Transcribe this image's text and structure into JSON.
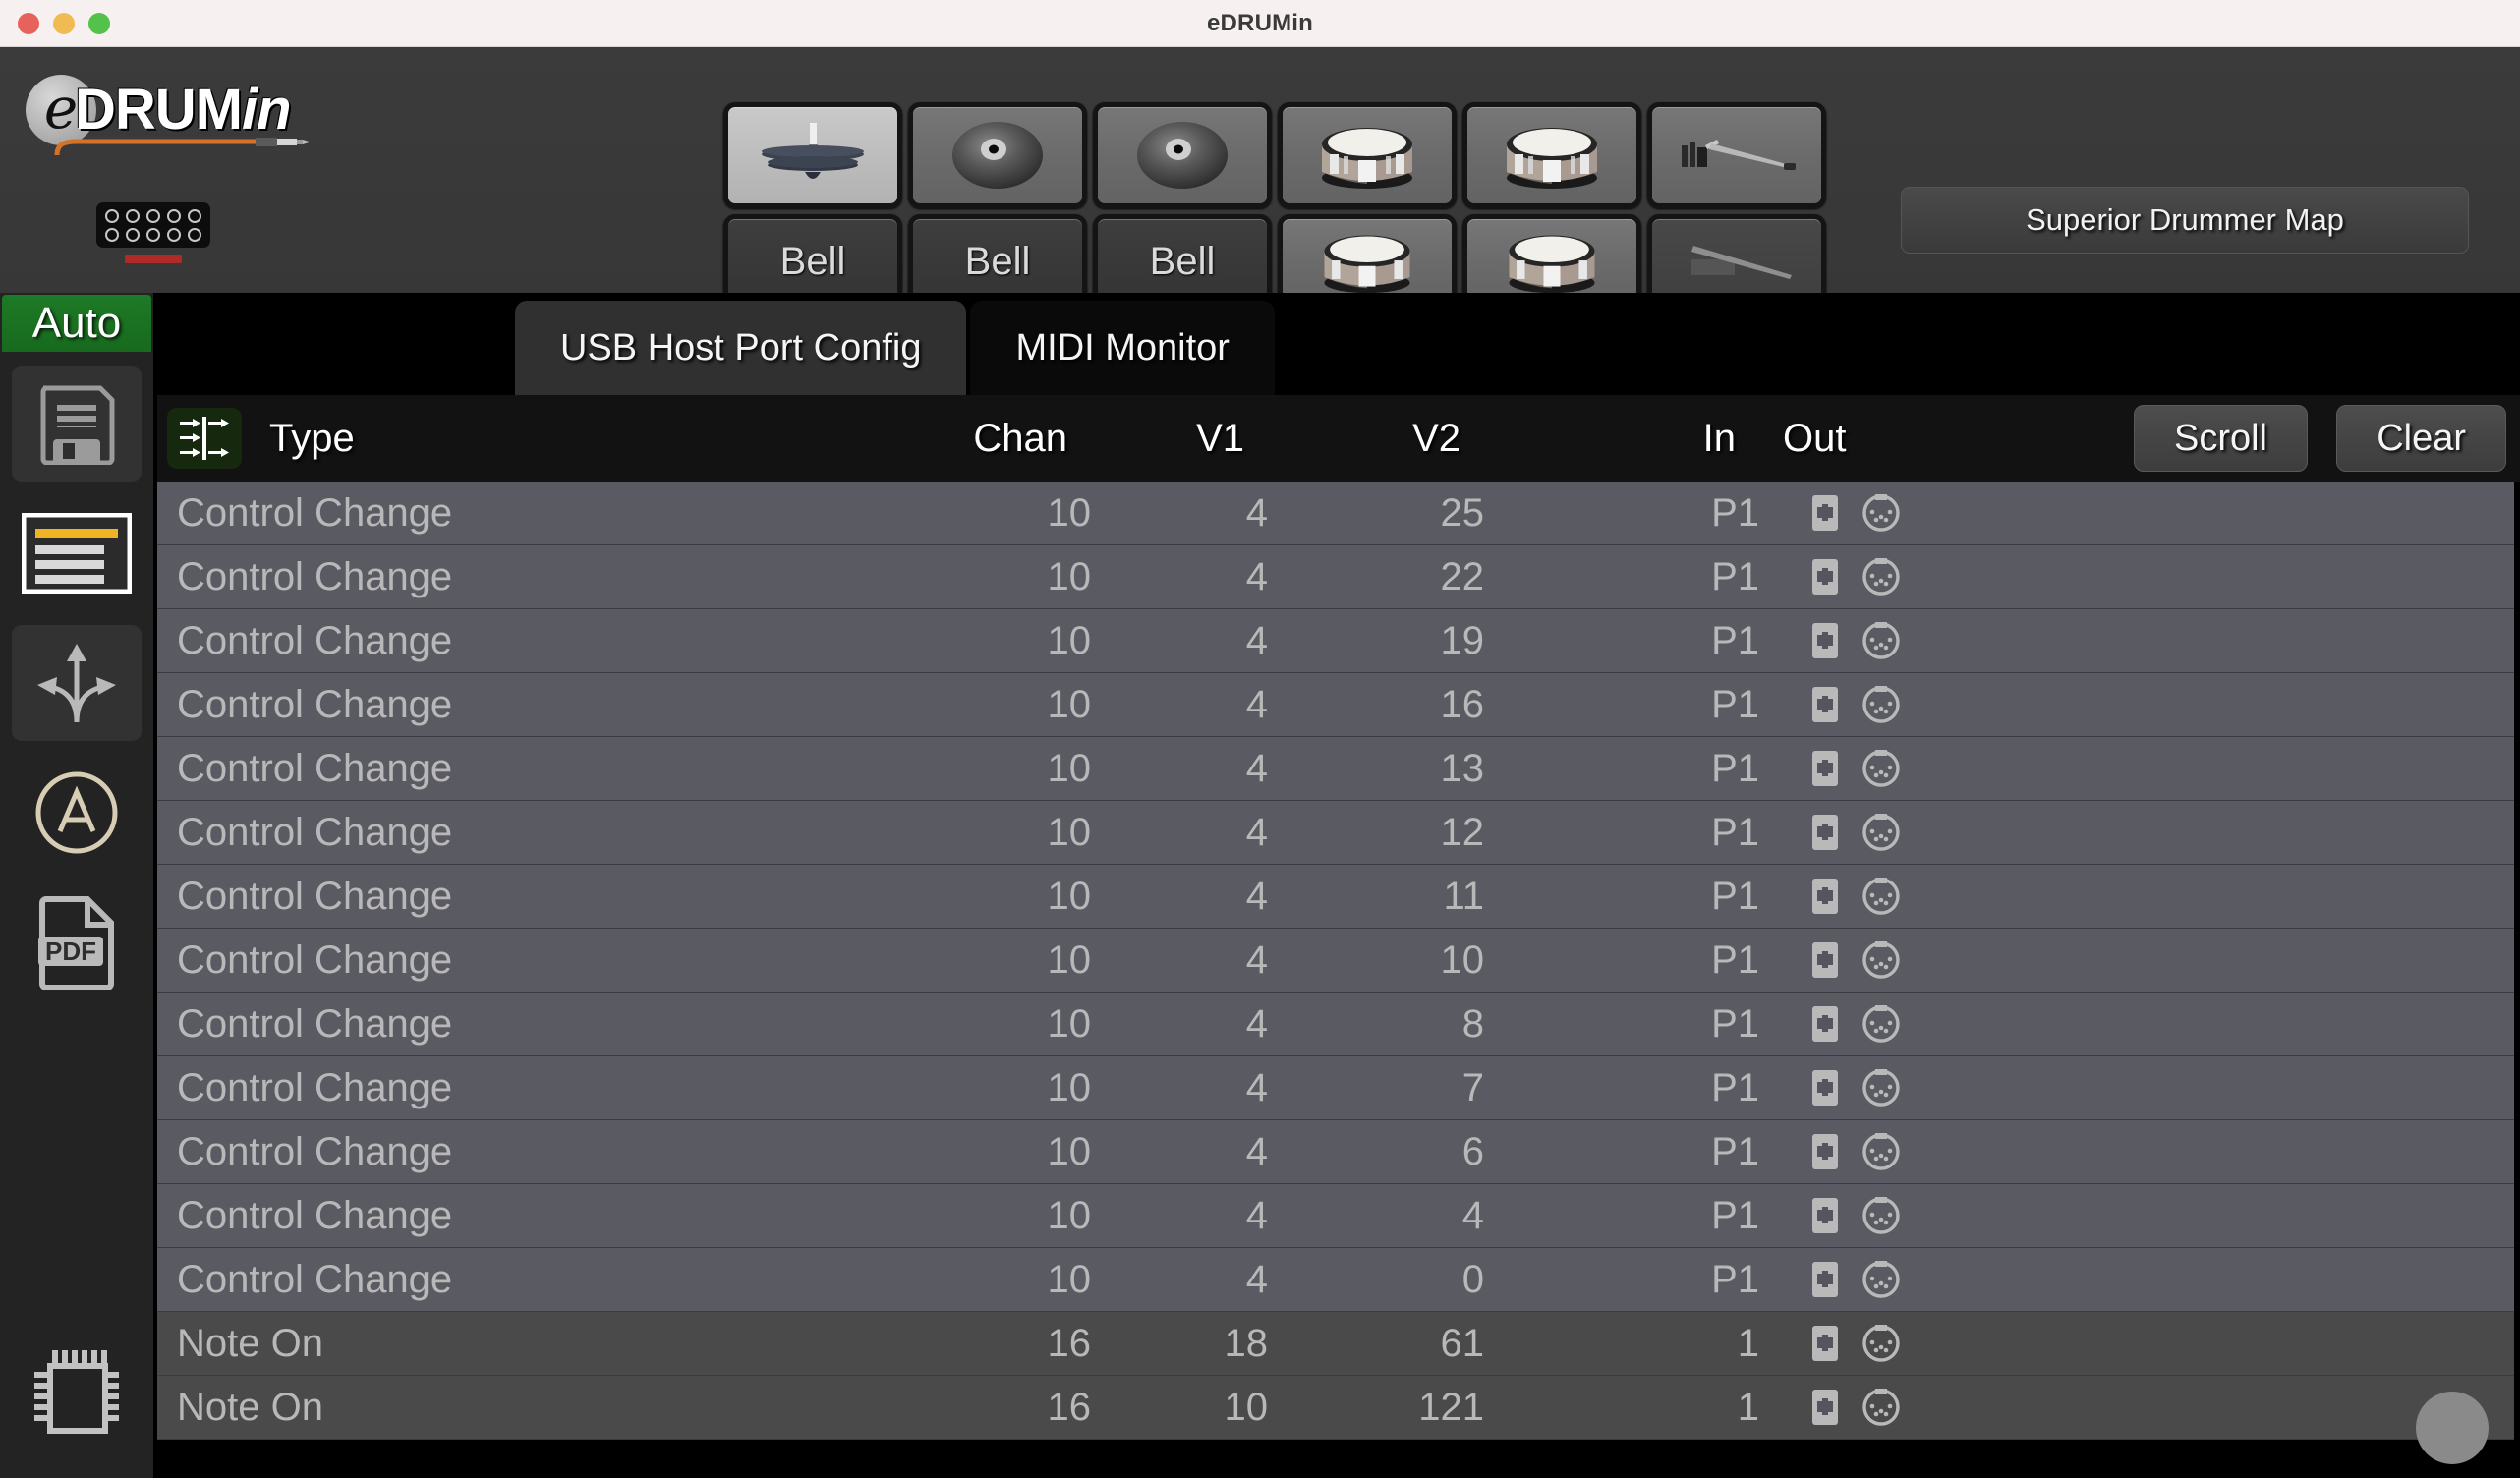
{
  "window": {
    "title": "eDRUMin"
  },
  "titlebar": {
    "close": "close-button",
    "minimize": "minimize-button",
    "maximize": "maximize-button"
  },
  "branding": {
    "logo_e": "e",
    "logo_text_main": "DRUM",
    "logo_text_italic": "in"
  },
  "device": {
    "holes": 10,
    "led_color": "#b02a28"
  },
  "pads": {
    "top_row": [
      {
        "icon": "hihat-icon",
        "selected": true
      },
      {
        "icon": "cymbal-icon",
        "selected": false
      },
      {
        "icon": "cymbal-icon",
        "selected": false
      },
      {
        "icon": "drum-icon",
        "selected": false
      },
      {
        "icon": "drum-icon",
        "selected": false
      },
      {
        "icon": "hihat-pedal-icon",
        "selected": false
      }
    ],
    "bottom_row": [
      {
        "label": "Bell",
        "icon": null
      },
      {
        "label": "Bell",
        "icon": null
      },
      {
        "label": "Bell",
        "icon": null
      },
      {
        "label": "",
        "icon": "drum-icon"
      },
      {
        "label": "",
        "icon": "drum-icon"
      },
      {
        "label": "",
        "icon": "hihat-pedal-faded-icon"
      }
    ]
  },
  "header": {
    "superior_drummer_map": "Superior Drummer Map"
  },
  "sidebar": {
    "auto_label": "Auto",
    "items": [
      {
        "name": "save-icon",
        "label": "save"
      },
      {
        "name": "list-icon",
        "label": "list"
      },
      {
        "name": "routing-arrows-icon",
        "label": "routing"
      },
      {
        "name": "circle-a-icon",
        "label": "circle-a"
      },
      {
        "name": "pdf-icon",
        "label": "pdf"
      },
      {
        "name": "chip-icon",
        "label": "chip"
      }
    ]
  },
  "tabs": [
    {
      "label": "USB Host Port Config",
      "active": true
    },
    {
      "label": "MIDI Monitor",
      "active": false
    }
  ],
  "monitor": {
    "filter_icon": "filter-routing-icon",
    "columns": [
      "Type",
      "Chan",
      "V1",
      "V2",
      "In",
      "Out"
    ],
    "scroll_label": "Scroll",
    "clear_label": "Clear",
    "out_icons": [
      "usb-port-icon",
      "midi-din-icon"
    ],
    "rows": [
      {
        "type": "Control Change",
        "chan": "10",
        "v1": "4",
        "v2": "25",
        "in": "P1",
        "kind": "cc"
      },
      {
        "type": "Control Change",
        "chan": "10",
        "v1": "4",
        "v2": "22",
        "in": "P1",
        "kind": "cc"
      },
      {
        "type": "Control Change",
        "chan": "10",
        "v1": "4",
        "v2": "19",
        "in": "P1",
        "kind": "cc"
      },
      {
        "type": "Control Change",
        "chan": "10",
        "v1": "4",
        "v2": "16",
        "in": "P1",
        "kind": "cc"
      },
      {
        "type": "Control Change",
        "chan": "10",
        "v1": "4",
        "v2": "13",
        "in": "P1",
        "kind": "cc"
      },
      {
        "type": "Control Change",
        "chan": "10",
        "v1": "4",
        "v2": "12",
        "in": "P1",
        "kind": "cc"
      },
      {
        "type": "Control Change",
        "chan": "10",
        "v1": "4",
        "v2": "11",
        "in": "P1",
        "kind": "cc"
      },
      {
        "type": "Control Change",
        "chan": "10",
        "v1": "4",
        "v2": "10",
        "in": "P1",
        "kind": "cc"
      },
      {
        "type": "Control Change",
        "chan": "10",
        "v1": "4",
        "v2": "8",
        "in": "P1",
        "kind": "cc"
      },
      {
        "type": "Control Change",
        "chan": "10",
        "v1": "4",
        "v2": "7",
        "in": "P1",
        "kind": "cc"
      },
      {
        "type": "Control Change",
        "chan": "10",
        "v1": "4",
        "v2": "6",
        "in": "P1",
        "kind": "cc"
      },
      {
        "type": "Control Change",
        "chan": "10",
        "v1": "4",
        "v2": "4",
        "in": "P1",
        "kind": "cc"
      },
      {
        "type": "Control Change",
        "chan": "10",
        "v1": "4",
        "v2": "0",
        "in": "P1",
        "kind": "cc"
      },
      {
        "type": "Note On",
        "chan": "16",
        "v1": "18",
        "v2": "61",
        "in": "1",
        "kind": "note"
      },
      {
        "type": "Note On",
        "chan": "16",
        "v1": "10",
        "v2": "121",
        "in": "1",
        "kind": "note"
      }
    ]
  },
  "colors": {
    "accent_green": "#1e7a26",
    "panel": "#3b3b3b",
    "row_cc": "#5a5a63",
    "row_note": "#4a4a4a",
    "led_red": "#b02a28",
    "list_highlight": "#f0b323"
  }
}
